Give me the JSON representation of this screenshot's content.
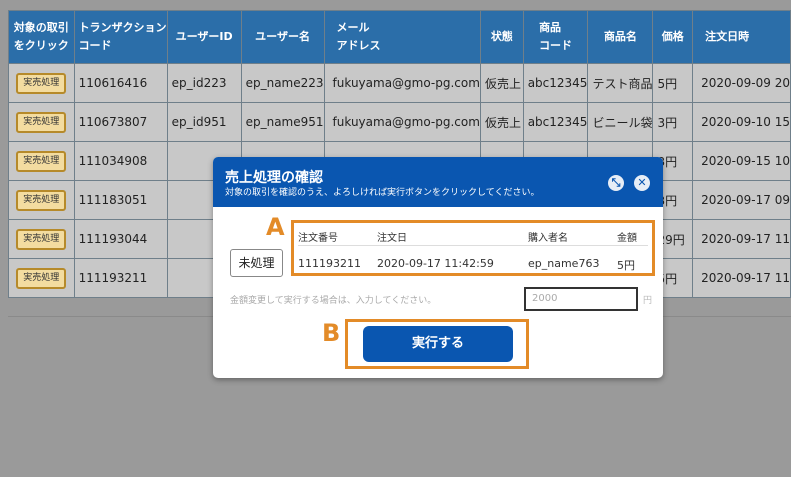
{
  "table": {
    "headers": [
      "対象の取引\nをクリック",
      "トランザクション\nコード",
      "ユーザーID",
      "ユーザー名",
      "メール\nアドレス",
      "状態",
      "商品\nコード",
      "商品名",
      "価格",
      "注文日時"
    ],
    "button_label": "実売処理",
    "rows": [
      [
        "110616416",
        "ep_id223",
        "ep_name223",
        "fukuyama@gmo-pg.com",
        "仮売上",
        "abc12345",
        "テスト商品",
        "5円",
        "2020-09-09 20"
      ],
      [
        "110673807",
        "ep_id951",
        "ep_name951",
        "fukuyama@gmo-pg.com",
        "仮売上",
        "abc12345",
        "ビニール袋",
        "3円",
        "2020-09-10 15"
      ],
      [
        "111034908",
        "",
        "",
        "",
        "",
        "",
        "",
        "3円",
        "2020-09-15 10"
      ],
      [
        "111183051",
        "",
        "",
        "",
        "",
        "",
        "",
        "3円",
        "2020-09-17 09"
      ],
      [
        "111193044",
        "",
        "",
        "",
        "",
        "",
        "",
        "29円",
        "2020-09-17 11"
      ],
      [
        "111193211",
        "",
        "",
        "",
        "",
        "",
        "",
        "5円",
        "2020-09-17 11"
      ]
    ]
  },
  "modal": {
    "title": "売上処理の確認",
    "subtitle": "対象の取引を確認のうえ、よろしければ実行ボタンをクリックしてください。",
    "status_button": "未処理",
    "order_headers": [
      "注文番号",
      "注文日",
      "購入者名",
      "金額"
    ],
    "order_row": [
      "111193211",
      "2020-09-17 11:42:59",
      "ep_name763",
      "5円"
    ],
    "amount_note": "金額変更して実行する場合は、入力してください。",
    "amount_placeholder": "2000",
    "amount_suffix": "円",
    "execute_label": "実行する"
  },
  "annotations": {
    "a": "A",
    "b": "B",
    "color": "#e38b28"
  },
  "colors": {
    "header_blue": "#2b6ea9",
    "modal_blue": "#0a56b0",
    "overlay": "#9a9a9a"
  }
}
